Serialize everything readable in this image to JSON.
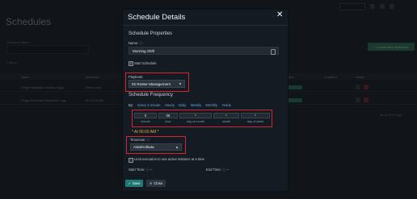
{
  "background": {
    "page_title": "Schedules",
    "search_label": "Schedule Name",
    "create_button": "+ Create New Schedule",
    "items_count": "2 items",
    "headers": [
      "Name",
      "Schedule",
      "Status",
      "Enabled",
      "Action"
    ],
    "rows": [
      {
        "name": "Purge Integration Action Logs",
        "schedule": "Every hour"
      },
      {
        "name": "Purge Executed Playbook Logs",
        "schedule": "At 12:00 AM"
      }
    ],
    "pager": "Items Per Page"
  },
  "modal": {
    "title": "Schedule Details",
    "close_glyph": "✕",
    "section_properties": "Schedule Properties",
    "name_label": "Name:",
    "name_value": "Morning Shift",
    "start_schedule_label": "Start Schedule",
    "start_schedule_checked": true,
    "playbook_label": "Playbook:",
    "playbook_value": "02 Roster Management",
    "section_frequency": "Schedule Frequency",
    "by_label": "By:",
    "frequency_options": [
      "Every X minute",
      "Hourly",
      "Daily",
      "Weekly",
      "Monthly",
      "Yearly"
    ],
    "cron": {
      "values": [
        "0",
        "06",
        "*",
        "*",
        "*"
      ],
      "labels": [
        "minute",
        "hour",
        "day of month",
        "month",
        "day of week"
      ]
    },
    "at_text": "* At 06:00 AM *",
    "timezone_label": "Timezone:",
    "timezone_value": "Asia/Kolkata",
    "limit_label": "Limit execution to one active instance at a time",
    "start_time_label": "Start Time:",
    "start_time_value": "--",
    "end_time_label": "End Time:",
    "end_time_value": "--",
    "save_label": "Save",
    "close_label": "Close"
  }
}
